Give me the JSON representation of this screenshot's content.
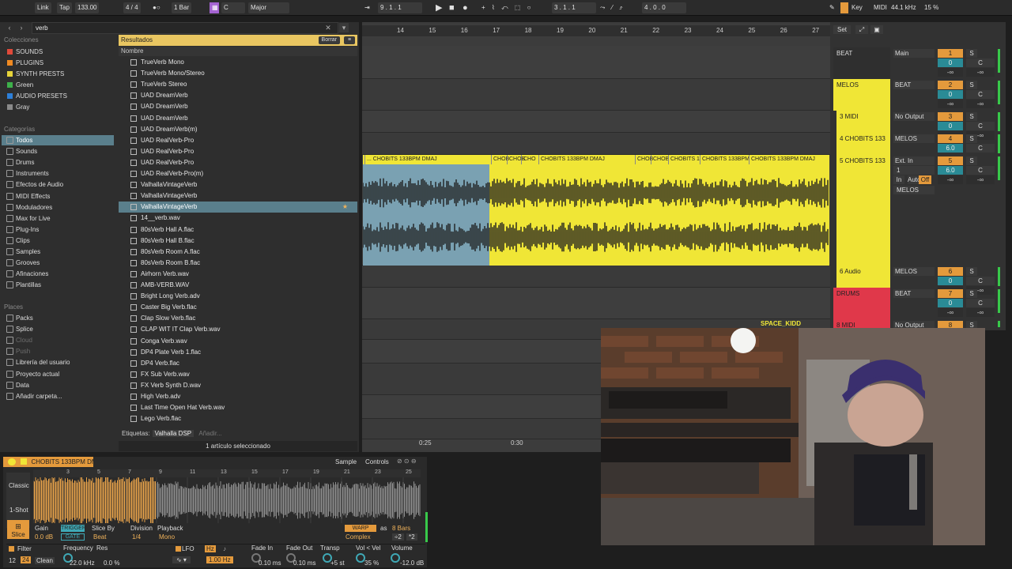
{
  "transport": {
    "link": "Link",
    "tap": "Tap",
    "tempo": "133.00",
    "signature": "4 / 4",
    "quantize": "1 Bar",
    "key_root": "C",
    "key_scale": "Major",
    "position": "9 .   1 .   1",
    "loop_start": "3 .   1 .   1",
    "loop_length": "4 .   0 .   0",
    "key_label": "Key",
    "midi_label": "MIDI",
    "sample_rate": "44.1 kHz",
    "cpu": "15 %"
  },
  "browser": {
    "search": "verb",
    "collections_header": "Colecciones",
    "collections": [
      {
        "label": "SOUNDS",
        "color": "#e04a3a"
      },
      {
        "label": "PLUGINS",
        "color": "#f08a22"
      },
      {
        "label": "SYNTH PRESTS",
        "color": "#e7d43a"
      },
      {
        "label": "Green",
        "color": "#3db04a"
      },
      {
        "label": "AUDIO PRESETS",
        "color": "#2d7fd8"
      },
      {
        "label": "Gray",
        "color": "#8a8a8a"
      }
    ],
    "categories_header": "Categorías",
    "categories": [
      "Todos",
      "Sounds",
      "Drums",
      "Instruments",
      "Efectos de Audio",
      "MIDI Effects",
      "Moduladores",
      "Max for Live",
      "Plug-Ins",
      "Clips",
      "Samples",
      "Grooves",
      "Afinaciones",
      "Plantillas"
    ],
    "places_header": "Places",
    "places": [
      "Packs",
      "Splice",
      "Cloud",
      "Push",
      "Librería del usuario",
      "Proyecto actual",
      "Data",
      "Añadir carpeta..."
    ],
    "results_label": "Resultados",
    "clear_label": "Borrar",
    "column_name": "Nombre",
    "files": [
      "TrueVerb Mono",
      "TrueVerb Mono/Stereo",
      "TrueVerb Stereo",
      "UAD DreamVerb",
      "UAD DreamVerb",
      "UAD DreamVerb",
      "UAD DreamVerb(m)",
      "UAD RealVerb-Pro",
      "UAD RealVerb-Pro",
      "UAD RealVerb-Pro",
      "UAD RealVerb-Pro(m)",
      "ValhallaVintageVerb",
      "ValhallaVintageVerb",
      "ValhallaVintageVerb",
      "14__verb.wav",
      "80sVerb Hall A.flac",
      "80sVerb Hall B.flac",
      "80sVerb Room A.flac",
      "80sVerb Room B.flac",
      "Airhorn Verb.wav",
      "AMB-VERB.WAV",
      "Bright Long Verb.adv",
      "Caster Big Verb.flac",
      "Clap Slow Verb.flac",
      "CLAP WIT IT Clap Verb.wav",
      "Conga Verb.wav",
      "DP4 Plate Verb 1.flac",
      "DP4 Verb.flac",
      "FX Sub Verb.wav",
      "FX Verb Synth D.wav",
      "High Verb.adv",
      "Last Time Open Hat Verb.wav",
      "Lego Verb.flac"
    ],
    "tags_label": "Etiquetas:",
    "tag_value": "Valhalla DSP",
    "tag_add": "Añadir...",
    "status": "1 artículo seleccionado"
  },
  "arrangement": {
    "bars": [
      "14",
      "15",
      "16",
      "17",
      "18",
      "19",
      "20",
      "21",
      "22",
      "23",
      "24",
      "25",
      "26",
      "27"
    ],
    "time_marks": [
      "0:25",
      "0:30"
    ],
    "clip_labels": [
      "... CHOBITS 133BPM DMAJ",
      "CHOB",
      "CHOB",
      "CHO",
      "CHOBITS 133BPM DMAJ",
      "CHOB",
      "CHOB",
      "CHOBITS 1",
      "CHOBITS 133BPM",
      "CHOBITS 133BPM DMAJ"
    ]
  },
  "mixer": {
    "set_label": "Set",
    "tracks": [
      {
        "name": "BEAT",
        "color": "#2f2f2f",
        "in": "Main",
        "num": "1"
      },
      {
        "name": "MELOS",
        "color": "#f0e636",
        "in": "BEAT",
        "num": "2"
      },
      {
        "name": "3 MIDI",
        "color": "#f0e636",
        "in": "No Output",
        "num": "3"
      },
      {
        "name": "4 CHOBITS 133",
        "color": "#f0e636",
        "in": "MELOS",
        "num": "4"
      },
      {
        "name": "5 CHOBITS 133",
        "color": "#f0e636",
        "in": "Ext. In",
        "num": "5"
      },
      {
        "name": "6 Audio",
        "color": "#f0e636",
        "in": "MELOS",
        "num": "6"
      },
      {
        "name": "DRUMS",
        "color": "#e0384a",
        "in": "BEAT",
        "num": "7"
      },
      {
        "name": "8 MIDI",
        "color": "#e0384a",
        "in": "No Output",
        "num": "8"
      }
    ],
    "gain_values": [
      "6.0",
      "6.0"
    ],
    "inf": "-∞",
    "monitor": [
      "In",
      "Auto",
      "Off"
    ],
    "sub_routing": "MELOS",
    "channel": "1"
  },
  "detail": {
    "clip_name": "CHOBITS 133BPM DMAJ",
    "tab_sample": "Sample",
    "tab_controls": "Controls",
    "mode_classic": "Classic",
    "mode_1shot": "1-Shot",
    "slice": "Slice",
    "gain_label": "Gain",
    "gain_value": "0.0 dB",
    "trigger": "TRIGGER",
    "gate": "GATE",
    "slice_by_label": "Slice By",
    "slice_by_value": "Beat",
    "division_label": "Division",
    "division_value": "1/4",
    "playback_label": "Playback",
    "playback_value": "Mono",
    "warp": "WARP",
    "as_label": "as",
    "bars_value": "8 Bars",
    "warp_mode": "Complex",
    "ruler": [
      "3",
      "5",
      "7",
      "9",
      "11",
      "13",
      "15",
      "17",
      "19",
      "21",
      "23",
      "25"
    ],
    "filter_label": "Filter",
    "filter_num1": "12",
    "filter_num2": "24",
    "filter_type": "Clean",
    "freq_label": "Frequency",
    "freq_value": "22.0 kHz",
    "res_label": "Res",
    "res_value": "0.0 %",
    "lfo_label": "LFO",
    "hz_label": "Hz",
    "lfo_value": "1.00 Hz",
    "fadein_label": "Fade In",
    "fadein_value": "0.10 ms",
    "fadeout_label": "Fade Out",
    "fadeout_value": "0.10 ms",
    "transp_label": "Transp",
    "transp_value": "+5 st",
    "volvel_label": "Vol < Vel",
    "volvel_value": "35 %",
    "volume_label": "Volume",
    "volume_value": "-12.0 dB",
    "div_a": "÷2",
    "div_b": "*2"
  },
  "camera": {
    "label": "SPACE_KIDD"
  }
}
